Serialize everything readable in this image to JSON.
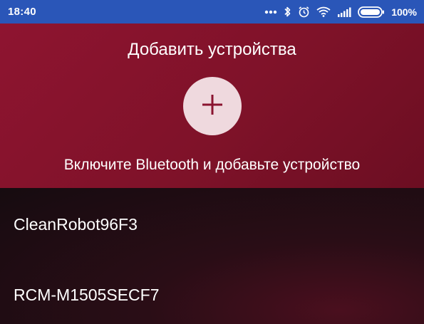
{
  "status_bar": {
    "time": "18:40",
    "battery": "100%",
    "icons": [
      "more-dots-icon",
      "bluetooth-icon",
      "alarm-icon",
      "wifi-icon",
      "signal-icon",
      "battery-icon"
    ]
  },
  "header": {
    "title": "Добавить устройства",
    "add_button_icon": "plus-icon",
    "hint": "Включите Bluetooth и добавьте устройство"
  },
  "devices": [
    {
      "name": "CleanRobot96F3"
    },
    {
      "name": "RCM-M1505SECF7"
    }
  ],
  "colors": {
    "status_bar": "#2a56b8",
    "header": "#8a1430",
    "add_button": "#efd9de",
    "plus": "#8a1430",
    "list_background": "#1a0f12"
  }
}
